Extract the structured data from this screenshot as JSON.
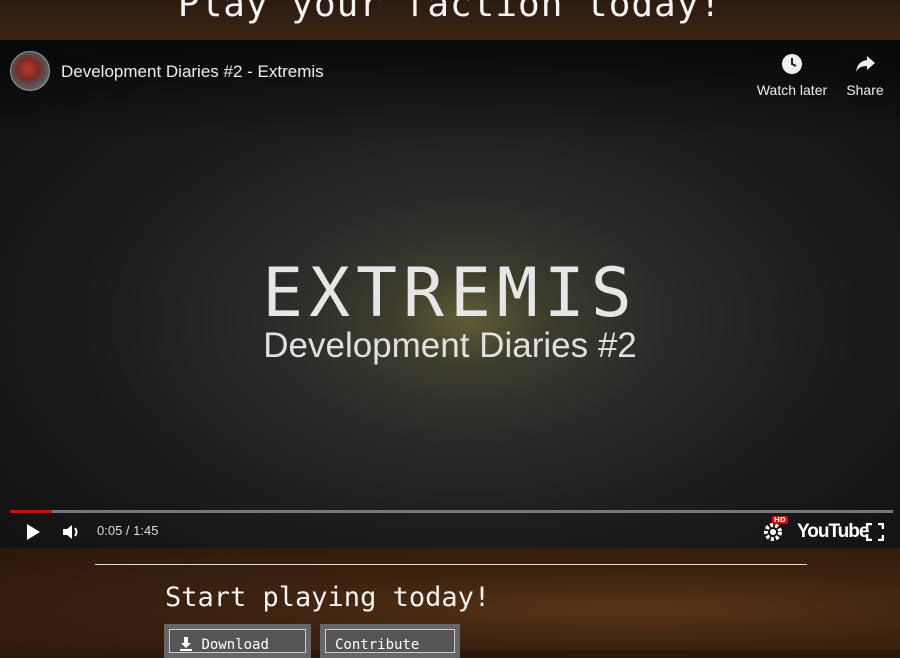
{
  "banner": {
    "headline": "Play your faction today!"
  },
  "video": {
    "title": "Development Diaries #2 - Extremis",
    "actions": {
      "watch_later": "Watch later",
      "share": "Share"
    },
    "thumbnail": {
      "title": "EXTREMIS",
      "subtitle": "Development Diaries #2"
    },
    "player": {
      "time": "0:05 / 1:45",
      "progress": 0.048,
      "brand": "YouTube",
      "hd_badge": "HD"
    },
    "colors": {
      "progress": "#ee0000",
      "hd_badge": "#ee0000"
    },
    "icons": [
      "play-icon",
      "volume-icon",
      "settings-icon",
      "fullscreen-icon",
      "clock-icon",
      "share-icon"
    ]
  },
  "cta": {
    "heading": "Start playing today!",
    "download_label": "Download",
    "contribute_label": "Contribute"
  }
}
